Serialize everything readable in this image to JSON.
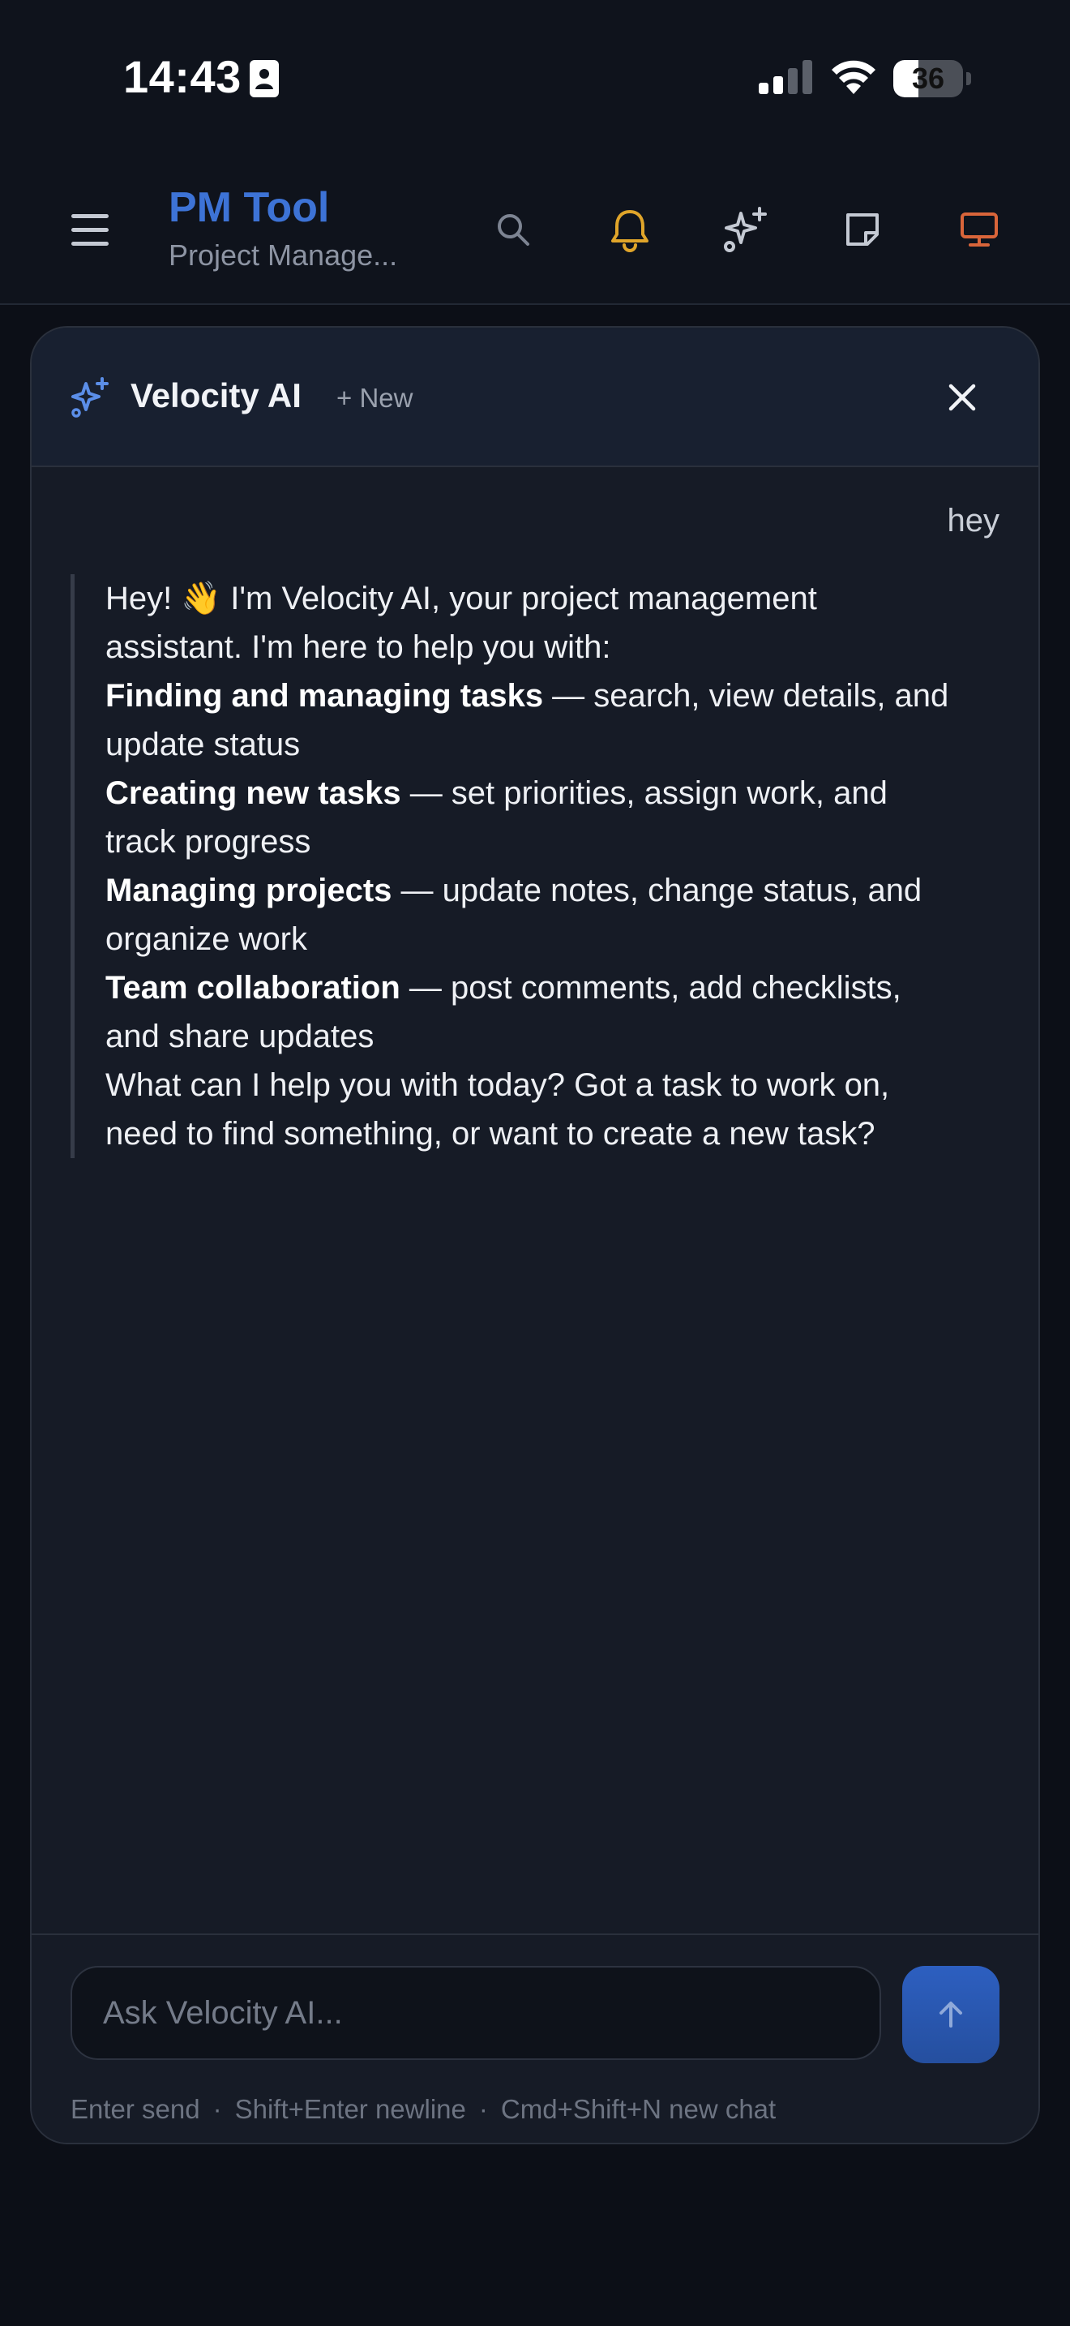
{
  "status_bar": {
    "time": "14:43",
    "battery": 36,
    "battery_label": "36"
  },
  "header": {
    "title": "PM Tool",
    "subtitle": "Project Manage...",
    "icons": [
      "menu-icon",
      "search-icon",
      "bell-icon",
      "sparkle-icon",
      "document-icon",
      "monitor-icon"
    ],
    "colors": {
      "title": "#3d73d6",
      "bell": "#e0a52a",
      "monitor": "#d9653a"
    }
  },
  "chat": {
    "title": "Velocity AI",
    "new_label": "+ New",
    "user_message": "hey",
    "assistant": {
      "intro": "Hey! 👋 I'm Velocity AI, your project management assistant. I'm here to help you with:",
      "items": [
        {
          "bold": "Finding and managing tasks",
          "text": " — search, view details, and update status"
        },
        {
          "bold": "Creating new tasks",
          "text": " — set priorities, assign work, and track progress"
        },
        {
          "bold": "Managing projects",
          "text": " — update notes, change status, and organize work"
        },
        {
          "bold": "Team collaboration",
          "text": " — post comments, add checklists, and share updates"
        }
      ],
      "outro": "What can I help you with today? Got a task to work on, need to find something, or want to create a new task?"
    },
    "input": {
      "placeholder": "Ask Velocity AI...",
      "value": ""
    },
    "hints": [
      "Enter send",
      "Shift+Enter newline",
      "Cmd+Shift+N new chat"
    ],
    "separator": "·"
  }
}
